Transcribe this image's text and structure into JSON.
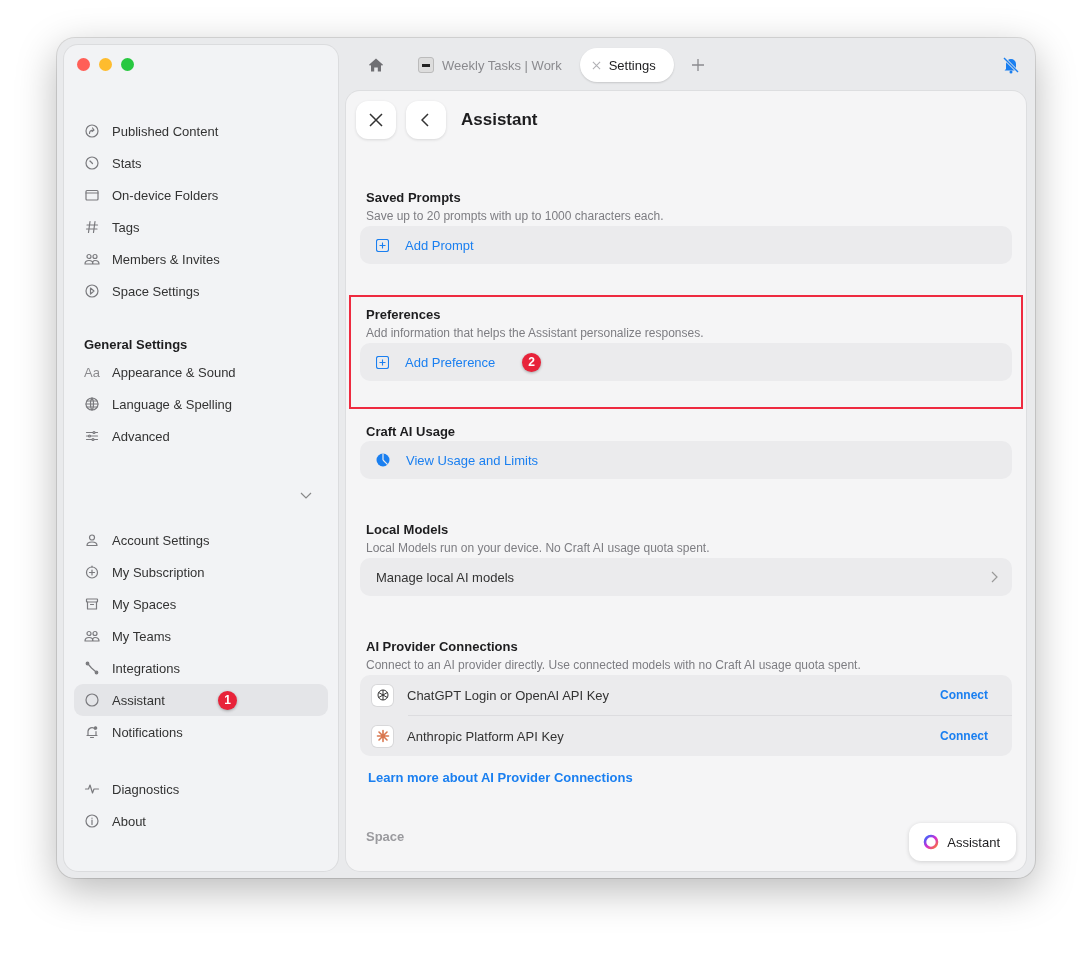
{
  "tabs": [
    {
      "label": "Weekly Tasks | Work",
      "selected": false
    },
    {
      "label": "Settings",
      "selected": true
    }
  ],
  "sidebar": {
    "groups": [
      {
        "items": [
          {
            "label": "Published Content",
            "selected": false
          },
          {
            "label": "Stats",
            "selected": false
          },
          {
            "label": "On-device Folders",
            "selected": false
          },
          {
            "label": "Tags",
            "selected": false
          },
          {
            "label": "Members & Invites",
            "selected": false
          },
          {
            "label": "Space Settings",
            "selected": false
          }
        ]
      },
      {
        "heading": "General Settings",
        "items": [
          {
            "label": "Appearance & Sound",
            "selected": false,
            "icon_text": "Aa"
          },
          {
            "label": "Language & Spelling",
            "selected": false
          },
          {
            "label": "Advanced",
            "selected": false
          }
        ]
      },
      {
        "items": [
          {
            "label": "Account Settings",
            "selected": false
          },
          {
            "label": "My Subscription",
            "selected": false
          },
          {
            "label": "My Spaces",
            "selected": false
          },
          {
            "label": "My Teams",
            "selected": false
          },
          {
            "label": "Integrations",
            "selected": false
          },
          {
            "label": "Assistant",
            "selected": true,
            "badge": "1"
          },
          {
            "label": "Notifications",
            "selected": false
          }
        ]
      },
      {
        "items": [
          {
            "label": "Diagnostics",
            "selected": false
          },
          {
            "label": "About",
            "selected": false
          }
        ]
      }
    ]
  },
  "page": {
    "title": "Assistant",
    "sections": [
      {
        "title": "Saved Prompts",
        "description": "Save up to 20 prompts with up to 1000 characters each.",
        "highlighted": false,
        "rows": [
          {
            "kind": "add",
            "label": "Add Prompt"
          }
        ]
      },
      {
        "title": "Preferences",
        "description": "Add information that helps the Assistant personalize responses.",
        "highlighted": true,
        "rows": [
          {
            "kind": "add",
            "label": "Add Preference",
            "badge": "2"
          }
        ]
      },
      {
        "title": "Craft AI Usage",
        "highlighted": false,
        "rows": [
          {
            "kind": "usage",
            "label": "View Usage and Limits"
          }
        ]
      },
      {
        "title": "Local Models",
        "description": "Local Models run on your device. No Craft AI usage quota spent.",
        "highlighted": false,
        "rows": [
          {
            "kind": "nav",
            "label": "Manage local AI models"
          }
        ]
      },
      {
        "title": "AI Provider Connections",
        "description": "Connect to an AI provider directly. Use connected models with no Craft AI usage quota spent.",
        "highlighted": false,
        "rows": [
          {
            "kind": "provider",
            "label": "ChatGPT Login or OpenAI API Key",
            "action": "Connect"
          },
          {
            "kind": "provider",
            "label": "Anthropic Platform API Key",
            "action": "Connect"
          }
        ],
        "link": "Learn more about AI Provider Connections"
      },
      {
        "title": "Space",
        "highlighted": false
      }
    ]
  },
  "floating_button": {
    "label": "Assistant"
  }
}
